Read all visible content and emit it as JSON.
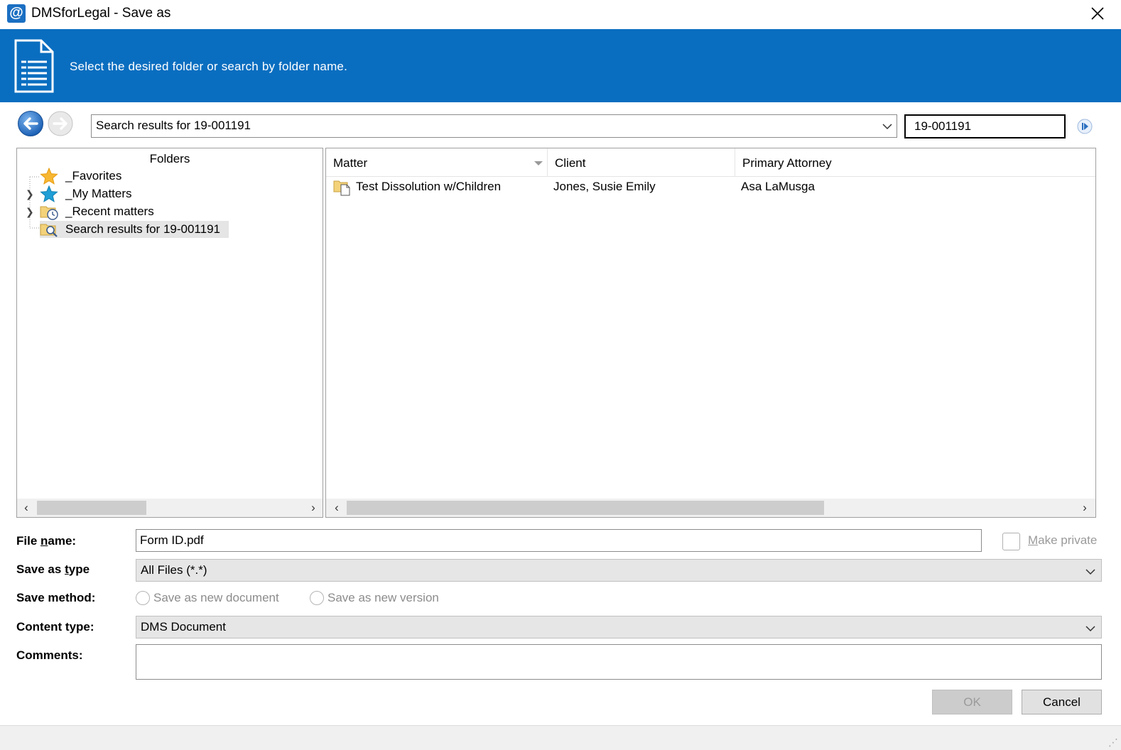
{
  "window": {
    "title": "DMSforLegal - Save as",
    "app_icon_glyph": "@",
    "close_icon": "close-icon"
  },
  "banner": {
    "text": "Select the desired folder or search by folder name.",
    "icon": "document-icon",
    "bg_color": "#0a6ec0"
  },
  "nav": {
    "location_value": "Search results for 19-001191",
    "search_value": "19-001191",
    "back_icon": "back-arrow-icon",
    "forward_icon": "forward-arrow-icon",
    "search_go_icon": "play-icon"
  },
  "folders": {
    "header": "Folders",
    "items": [
      {
        "label": "_Favorites",
        "icon": "star-icon",
        "expandable": false,
        "selected": false
      },
      {
        "label": "_My Matters",
        "icon": "star-teal-icon",
        "expandable": true,
        "selected": false
      },
      {
        "label": "_Recent matters",
        "icon": "clock-folder-icon",
        "expandable": true,
        "selected": false
      },
      {
        "label": "Search results for 19-001191",
        "icon": "search-folder-icon",
        "expandable": false,
        "selected": true
      }
    ]
  },
  "list": {
    "columns": [
      "Matter",
      "Client",
      "Primary Attorney"
    ],
    "rows": [
      {
        "matter": "Test Dissolution w/Children",
        "client": "Jones, Susie Emily",
        "attorney": "Asa LaMusga",
        "icon": "matter-folder-icon"
      }
    ]
  },
  "form": {
    "file_name_label_pre": "File ",
    "file_name_label_mn": "n",
    "file_name_label_post": "ame:",
    "file_name_value": "Form ID.pdf",
    "make_private_mn": "M",
    "make_private_rest": "ake private",
    "save_as_type_label_pre": "Save as ",
    "save_as_type_label_mn": "t",
    "save_as_type_label_post": "ype",
    "save_as_type_value": "All Files (*.*)",
    "save_method_label": "Save method:",
    "save_method_options": [
      "Save as new document",
      "Save as new version"
    ],
    "content_type_label": "Content type:",
    "content_type_value": "DMS Document",
    "comments_label": "Comments:",
    "comments_value": ""
  },
  "buttons": {
    "ok": "OK",
    "cancel": "Cancel"
  }
}
